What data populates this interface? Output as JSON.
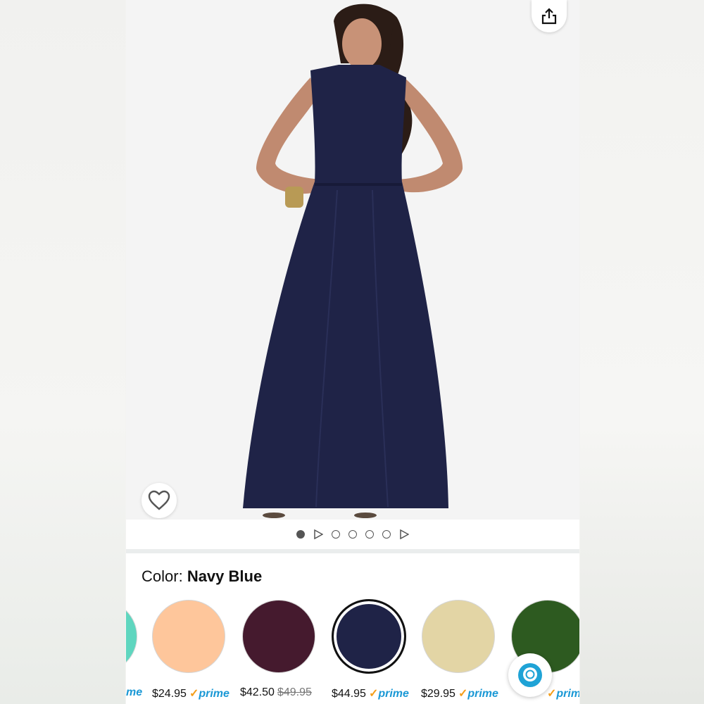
{
  "product": {
    "image_alt": "Woman in navy blue halter maxi dress"
  },
  "pager": {
    "total": 7,
    "active_index": 0
  },
  "color": {
    "label": "Color:",
    "selected": "Navy Blue"
  },
  "swatches": [
    {
      "name": "Mint",
      "hex": "#5fd6bf",
      "price": "",
      "prime_text": "me"
    },
    {
      "name": "Peach",
      "hex": "#fec69b",
      "price": "$24.95",
      "prime_text": "prime"
    },
    {
      "name": "Plum",
      "hex": "#451a2e",
      "price": "$42.50",
      "old_price": "$49.95"
    },
    {
      "name": "Navy Blue",
      "hex": "#1f2347",
      "price": "$44.95",
      "prime_text": "prime",
      "selected": true
    },
    {
      "name": "Champagne",
      "hex": "#e3d5a5",
      "price": "$29.95",
      "prime_text": "prime"
    },
    {
      "name": "Olive",
      "hex": "#2d5a20",
      "price": "",
      "prime_text": "prim"
    }
  ],
  "icons": {
    "share": "share-icon",
    "wishlist": "heart-icon",
    "alexa": "alexa-icon"
  },
  "colors": {
    "accent_prime": "#1a98d5",
    "prime_check": "#f49d1a",
    "dress": "#1f2347"
  }
}
